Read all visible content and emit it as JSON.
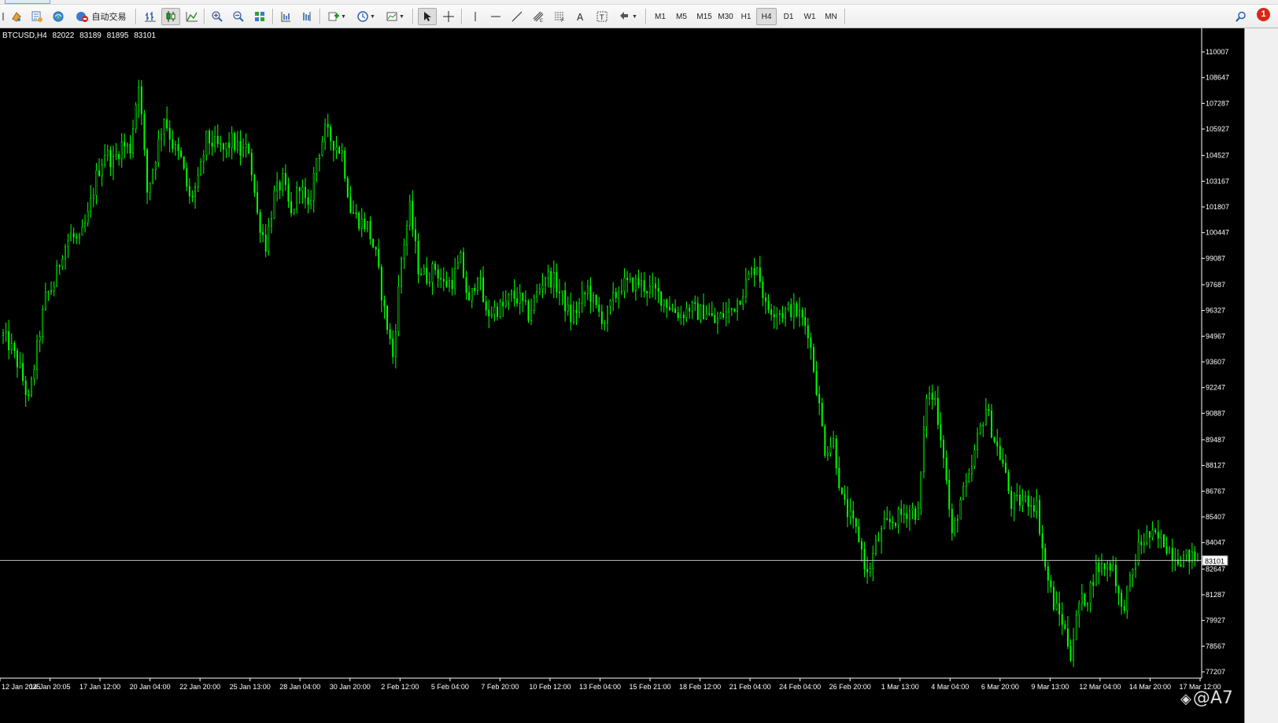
{
  "app": {
    "auto_trade_label": "自动交易",
    "alert_count": "1",
    "watermark_text": "@A7"
  },
  "toolbar": {
    "timeframes": [
      "M1",
      "M5",
      "M15",
      "M30",
      "H1",
      "H4",
      "D1",
      "W1",
      "MN"
    ],
    "active_timeframe": "H4"
  },
  "chart": {
    "symbol_label": "BTCUSD,H4",
    "ohlc": [
      "82022",
      "83189",
      "81895",
      "83101"
    ],
    "current_price": 83101,
    "current_price_label": "83101",
    "colors": {
      "background": "#000000",
      "candle": "#00ff00",
      "axis": "#ffffff",
      "bid_line": "#c0c0c0"
    }
  },
  "chart_data": {
    "type": "bar",
    "style": "candlestick",
    "title": "",
    "xlabel": "",
    "ylabel": "",
    "ylim": [
      76000,
      111000
    ],
    "grid": false,
    "y_ticks": [
      110007,
      108647,
      107287,
      105927,
      104527,
      103167,
      101807,
      100447,
      99087,
      97687,
      96327,
      94967,
      93607,
      92247,
      90887,
      89487,
      88127,
      86767,
      85407,
      84047,
      82647,
      81287,
      79927,
      78567,
      77207
    ],
    "x_ticks": [
      "12 Jan 2025",
      "14 Jan 20:05",
      "17 Jan 12:00",
      "20 Jan 04:00",
      "22 Jan 20:00",
      "25 Jan 13:00",
      "28 Jan 04:00",
      "30 Jan 20:00",
      "2 Feb 12:00",
      "5 Feb 04:00",
      "7 Feb 20:00",
      "10 Feb 12:00",
      "13 Feb 04:00",
      "15 Feb 21:00",
      "18 Feb 12:00",
      "21 Feb 04:00",
      "24 Feb 04:00",
      "26 Feb 20:00",
      "1 Mar 13:00",
      "4 Mar 04:00",
      "6 Mar 20:00",
      "9 Mar 13:00",
      "12 Mar 04:00",
      "14 Mar 20:00",
      "17 Mar 12:00"
    ],
    "series": [
      {
        "values": [
          95000,
          94300,
          93200,
          91500,
          94300,
          97000,
          97700,
          99500,
          100300,
          99900,
          101300,
          103400,
          104700,
          104200,
          105100,
          104900,
          108500,
          102600,
          104500,
          106600,
          105100,
          104300,
          102200,
          103100,
          105400,
          105100,
          104800,
          105300,
          104700,
          104900,
          101400,
          99800,
          102400,
          103200,
          101300,
          103100,
          101500,
          104400,
          105800,
          105200,
          104700,
          101700,
          101100,
          100800,
          99200,
          96300,
          93900,
          99100,
          101700,
          98600,
          98100,
          98600,
          97700,
          97900,
          99000,
          96600,
          98400,
          96100,
          96400,
          96500,
          97100,
          96900,
          96100,
          97200,
          98200,
          97900,
          97000,
          95900,
          96600,
          97500,
          96400,
          95800,
          96900,
          97700,
          97700,
          97800,
          97500,
          97300,
          96900,
          96400,
          96100,
          96500,
          96200,
          96300,
          95700,
          96100,
          96400,
          97100,
          98100,
          98800,
          96500,
          96400,
          96200,
          96400,
          96100,
          95300,
          92300,
          89000,
          89400,
          86300,
          85300,
          84300,
          82300,
          83900,
          84900,
          85200,
          85500,
          85800,
          85600,
          91900,
          91600,
          88800,
          84300,
          86300,
          87300,
          89500,
          91200,
          89500,
          88200,
          86100,
          86200,
          86300,
          86000,
          82700,
          80800,
          79900,
          78200,
          80800,
          81200,
          82700,
          82800,
          82900,
          80400,
          81900,
          83800,
          84400,
          84300,
          84100,
          83500,
          83200,
          83300,
          83101
        ]
      }
    ]
  }
}
